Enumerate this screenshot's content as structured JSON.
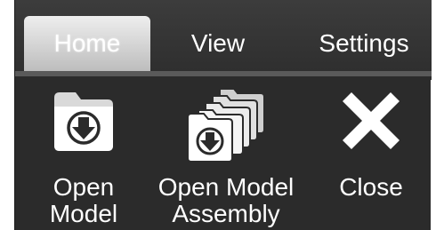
{
  "tabs": {
    "home": "Home",
    "view": "View",
    "settings": "Settings"
  },
  "commands": {
    "open_model_line1": "Open",
    "open_model_line2": "Model",
    "open_assembly_line1": "Open Model",
    "open_assembly_line2": "Assembly",
    "close": "Close"
  },
  "colors": {
    "ribbon_bg": "#2b2b2b",
    "active_tab": "#cfcfcf",
    "text": "#ffffff"
  },
  "icons": {
    "open_model": "folder-download-icon",
    "open_assembly": "stacked-folders-download-icon",
    "close": "close-x-icon"
  }
}
